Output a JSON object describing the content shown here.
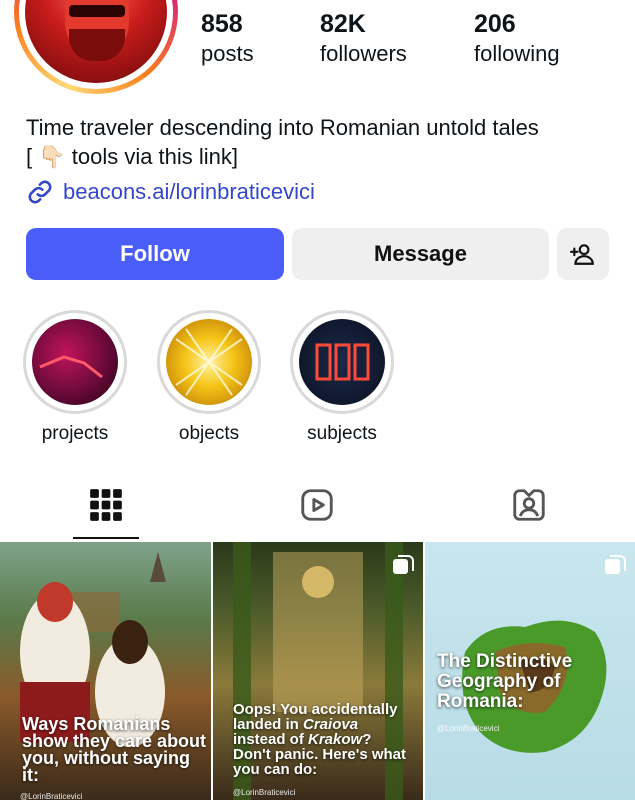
{
  "profile": {
    "stats": {
      "posts": {
        "value": "858",
        "label": "posts"
      },
      "followers": {
        "value": "82K",
        "label": "followers"
      },
      "following": {
        "value": "206",
        "label": "following"
      }
    },
    "bio_line1": "Time traveler descending into Romanian untold tales",
    "bio_line2": "[ 👇🏻 tools via this link]",
    "link": "beacons.ai/lorinbraticevici"
  },
  "actions": {
    "follow_label": "Follow",
    "message_label": "Message",
    "add_user_icon": "add-user-icon"
  },
  "highlights": [
    {
      "label": "projects"
    },
    {
      "label": "objects"
    },
    {
      "label": "subjects"
    }
  ],
  "tabs": [
    {
      "icon": "grid-icon",
      "active": true
    },
    {
      "icon": "reels-icon",
      "active": false
    },
    {
      "icon": "tagged-icon",
      "active": false
    }
  ],
  "posts": [
    {
      "caption": "Ways Romanians show they care about you, without saying it:",
      "handle": "@LorinBraticevici"
    },
    {
      "caption_line1": "Oops! You accidentally",
      "caption_line2a": "landed in ",
      "caption_city1": "Craiova",
      "caption_line3a": "instead of ",
      "caption_city2": "Krakow",
      "caption_line3b": "?",
      "caption_line4": "Don't panic. Here's what you can do:",
      "handle": "@LorinBraticevici"
    },
    {
      "caption": "The Distinctive Geography of Romania:",
      "handle": "@LorinBraticevici"
    }
  ],
  "colors": {
    "follow_button": "#4a5df9",
    "link": "#3447c9"
  }
}
